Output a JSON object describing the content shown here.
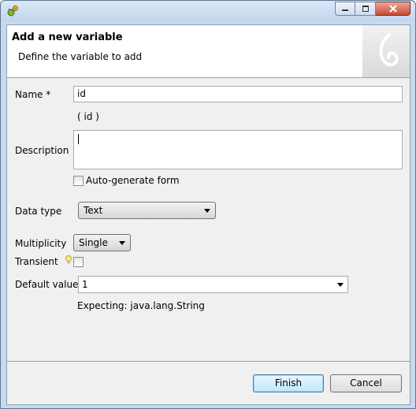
{
  "window": {
    "icons": {
      "app": "bug-gear-icon",
      "minimize": "minimize-icon",
      "maximize": "maximize-icon",
      "close": "close-icon"
    }
  },
  "header": {
    "title": "Add a new variable",
    "description": "Define the variable to add",
    "logo_icon": "swirl-logo-icon"
  },
  "form": {
    "name_label": "Name *",
    "name_value": "id",
    "name_preview": "( id )",
    "description_label": "Description",
    "description_value": "",
    "autogen_label": "Auto-generate form",
    "autogen_checked": false,
    "datatype_label": "Data type",
    "datatype_value": "Text",
    "multiplicity_label": "Multiplicity",
    "multiplicity_value": "Single",
    "transient_label": "Transient",
    "transient_checked": false,
    "transient_hint_icon": "lightbulb-icon",
    "default_label": "Default value",
    "default_value": "1",
    "expecting_text": "Expecting: java.lang.String"
  },
  "buttons": {
    "finish": "Finish",
    "cancel": "Cancel"
  },
  "colors": {
    "titlebar": "#c3d5ec",
    "close_button": "#c74a34",
    "dialog_bg": "#f0f0f0",
    "default_button_border": "#3c7fb1"
  }
}
